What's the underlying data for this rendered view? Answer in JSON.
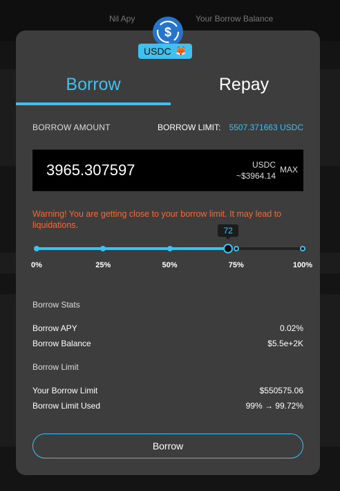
{
  "background": {
    "nav_items": [
      "Nil Apy",
      "Your Borrow Balance"
    ]
  },
  "token": {
    "symbol": "USDC",
    "wallet_emoji": "🦊",
    "logo_icon": "usdc-dollar-icon",
    "accent_color": "#3fc1f0"
  },
  "tabs": [
    {
      "label": "Borrow",
      "active": true
    },
    {
      "label": "Repay",
      "active": false
    }
  ],
  "borrow_form": {
    "amount_label": "BORROW AMOUNT",
    "limit_label": "BORROW LIMIT:",
    "limit_value": "5507.371663 USDC",
    "amount_value": "3965.307597",
    "amount_unit": "USDC",
    "amount_usd": "~$3964.14",
    "max_label": "MAX",
    "warning": "Warning! You are getting close to your borrow limit. It may lead to liquidations."
  },
  "slider": {
    "value": 72,
    "value_label": "72",
    "ticks": [
      0,
      25,
      50,
      75,
      100
    ],
    "tick_labels": [
      "0%",
      "25%",
      "50%",
      "75%",
      "100%"
    ]
  },
  "stats": {
    "title": "Borrow Stats",
    "rows": [
      {
        "label": "Borrow APY",
        "value": "0.02%"
      },
      {
        "label": "Borrow Balance",
        "value": "$5.5e+2K"
      }
    ]
  },
  "limit": {
    "title": "Borrow Limit",
    "rows": [
      {
        "label": "Your Borrow Limit",
        "value": "$550575.06"
      },
      {
        "label": "Borrow Limit Used",
        "value": "99% → 99.72%"
      }
    ]
  },
  "submit_label": "Borrow"
}
